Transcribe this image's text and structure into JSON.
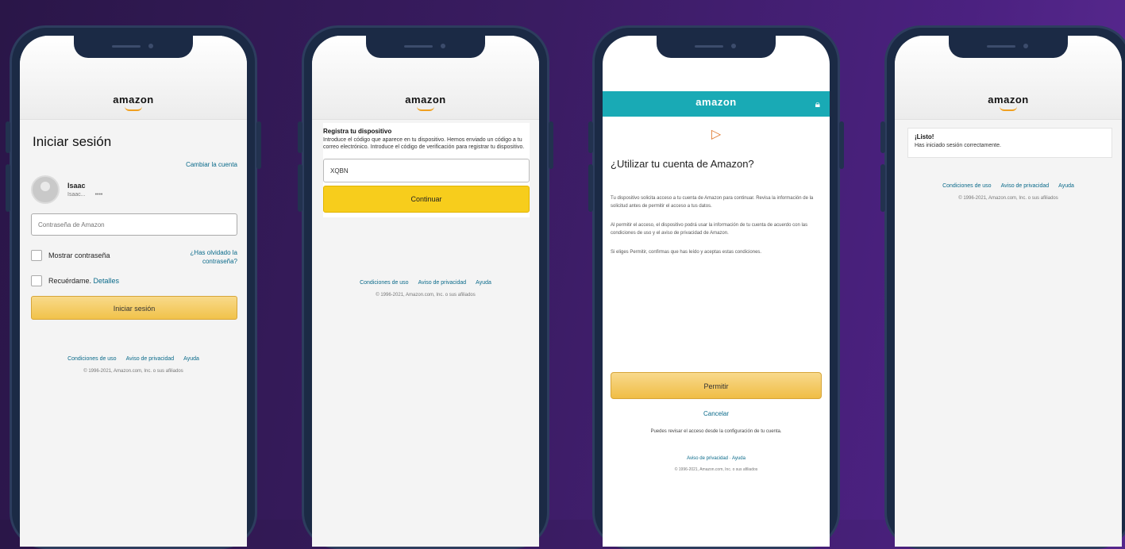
{
  "phones": [
    {
      "brand": "amazon",
      "title": "Iniciar sesión",
      "change_link": "Cambiar la cuenta",
      "user": {
        "name": "Isaac",
        "sub_left": "Isaac...",
        "sub_right": "••••"
      },
      "password_placeholder": "Contraseña de Amazon",
      "show_password_label": "Mostrar contraseña",
      "forgot_link": "¿Has olvidado la contraseña?",
      "remember_label": "Recuérdame.",
      "remember_link": "Detalles",
      "signin_button": "Iniciar sesión",
      "footer_links": [
        "Condiciones de uso",
        "Aviso de privacidad",
        "Ayuda"
      ],
      "footer_copy": "© 1996-2021, Amazon.com, Inc. o sus afiliados"
    },
    {
      "brand": "amazon",
      "heading": "Registra tu dispositivo",
      "text": "Introduce el código que aparece en tu dispositivo. Hemos enviado un código a tu correo electrónico. Introduce el código de verificación para registrar tu dispositivo.",
      "code_value": "XQBN",
      "continue_button": "Continuar",
      "footer_links": [
        "Condiciones de uso",
        "Aviso de privacidad",
        "Ayuda"
      ],
      "footer_copy": "© 1996-2021, Amazon.com, Inc. o sus afiliados"
    },
    {
      "brand": "amazon",
      "title": "¿Utilizar tu cuenta de Amazon?",
      "paragraphs": [
        "Tu dispositivo solicita acceso a tu cuenta de Amazon para continuar. Revisa la información de la solicitud antes de permitir el acceso a tus datos.",
        "Al permitir el acceso, el dispositivo podrá usar la información de tu cuenta de acuerdo con las condiciones de uso y el aviso de privacidad de Amazon.",
        "Si eliges Permitir, confirmas que has leído y aceptas estas condiciones."
      ],
      "allow_button": "Permitir",
      "cancel_link": "Cancelar",
      "note": "Puedes revisar el acceso desde la configuración de tu cuenta.",
      "footer_links": "Aviso de privacidad · Ayuda",
      "footer_copy": "© 1996-2021, Amazon.com, Inc. o sus afiliados"
    },
    {
      "brand": "amazon",
      "heading": "¡Listo!",
      "text": "Has iniciado sesión correctamente.",
      "footer_links": [
        "Condiciones de uso",
        "Aviso de privacidad",
        "Ayuda"
      ],
      "footer_copy": "© 1996-2021, Amazon.com, Inc. o sus afiliados"
    }
  ]
}
